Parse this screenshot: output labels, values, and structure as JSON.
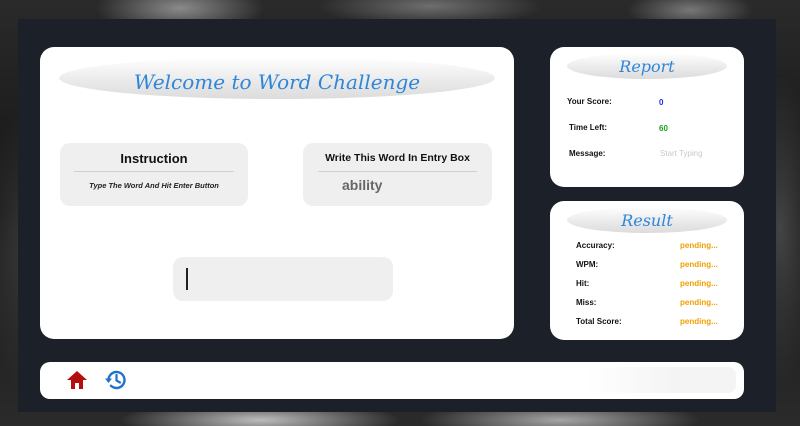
{
  "main": {
    "title": "Welcome to Word Challenge",
    "instruction": {
      "heading": "Instruction",
      "text": "Type The Word And Hit Enter Button"
    },
    "word_prompt": {
      "heading": "Write This Word In Entry Box",
      "word": "ability"
    },
    "entry": {
      "value": ""
    }
  },
  "report": {
    "title": "Report",
    "rows": [
      {
        "label": "Your Score:",
        "value": "0",
        "color": "#1a2cf0"
      },
      {
        "label": "Time Left:",
        "value": "60",
        "color": "#1e9d1e"
      },
      {
        "label": "Message:",
        "value": "Start Typing",
        "color": "#c9c9c9"
      }
    ]
  },
  "result": {
    "title": "Result",
    "rows": [
      {
        "label": "Accuracy:",
        "value": "pending..."
      },
      {
        "label": "WPM:",
        "value": "pending..."
      },
      {
        "label": "Hit:",
        "value": "pending..."
      },
      {
        "label": "Miss:",
        "value": "pending..."
      },
      {
        "label": "Total Score:",
        "value": "pending..."
      }
    ],
    "value_color": "#f0a000"
  },
  "toolbar": {
    "home_icon": "home-icon",
    "history_icon": "history-icon"
  }
}
